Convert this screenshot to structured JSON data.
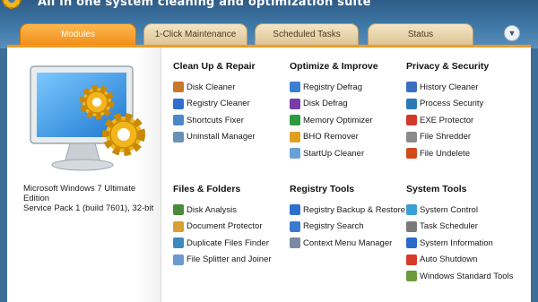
{
  "header": {
    "tagline": "All in one system cleaning and optimization suite"
  },
  "tabs": [
    {
      "label": "Modules",
      "active": true
    },
    {
      "label": "1-Click Maintenance",
      "active": false
    },
    {
      "label": "Scheduled Tasks",
      "active": false
    },
    {
      "label": "Status",
      "active": false
    }
  ],
  "menu_button_icon": "chevron-down-icon",
  "system": {
    "os_info": "Microsoft Windows 7 Ultimate Edition\nService Pack 1 (build 7601), 32-bit"
  },
  "sections": [
    {
      "title": "Clean Up & Repair",
      "items": [
        {
          "label": "Disk Cleaner",
          "icon": "broom-icon",
          "color": "#c9772a"
        },
        {
          "label": "Registry Cleaner",
          "icon": "registry-cube-icon",
          "color": "#2f6fd0"
        },
        {
          "label": "Shortcuts Fixer",
          "icon": "shortcut-icon",
          "color": "#4a89c8"
        },
        {
          "label": "Uninstall Manager",
          "icon": "uninstall-icon",
          "color": "#6a8fb8"
        }
      ]
    },
    {
      "title": "Optimize & Improve",
      "items": [
        {
          "label": "Registry Defrag",
          "icon": "defrag-icon",
          "color": "#3a7fd0"
        },
        {
          "label": "Disk Defrag",
          "icon": "disk-defrag-icon",
          "color": "#7a3aa8"
        },
        {
          "label": "Memory Optimizer",
          "icon": "memory-icon",
          "color": "#2e9a3e"
        },
        {
          "label": "BHO Remover",
          "icon": "bho-icon",
          "color": "#e0a020"
        },
        {
          "label": "StartUp Cleaner",
          "icon": "startup-icon",
          "color": "#6aa0d8"
        }
      ]
    },
    {
      "title": "Privacy & Security",
      "items": [
        {
          "label": "History Cleaner",
          "icon": "history-icon",
          "color": "#3a6fc0"
        },
        {
          "label": "Process Security",
          "icon": "process-icon",
          "color": "#2a7ab8"
        },
        {
          "label": "EXE Protector",
          "icon": "exe-shield-icon",
          "color": "#d23a2a"
        },
        {
          "label": "File Shredder",
          "icon": "shredder-icon",
          "color": "#8a8a8a"
        },
        {
          "label": "File Undelete",
          "icon": "undelete-icon",
          "color": "#d04a1a"
        }
      ]
    },
    {
      "title": "Files & Folders",
      "items": [
        {
          "label": "Disk Analysis",
          "icon": "disk-analysis-icon",
          "color": "#4a8a3a"
        },
        {
          "label": "Document Protector",
          "icon": "document-icon",
          "color": "#d8a030"
        },
        {
          "label": "Duplicate Files Finder",
          "icon": "duplicate-icon",
          "color": "#3a8ac0"
        },
        {
          "label": "File Splitter and Joiner",
          "icon": "splitter-icon",
          "color": "#6a9ad0"
        }
      ]
    },
    {
      "title": "Registry Tools",
      "items": [
        {
          "label": "Registry Backup & Restore",
          "icon": "registry-backup-icon",
          "color": "#2f6fd0"
        },
        {
          "label": "Registry Search",
          "icon": "registry-search-icon",
          "color": "#3a7ad0"
        },
        {
          "label": "Context Menu Manager",
          "icon": "context-menu-icon",
          "color": "#7a8aa0"
        }
      ]
    },
    {
      "title": "System Tools",
      "items": [
        {
          "label": "System Control",
          "icon": "system-control-icon",
          "color": "#3aa0d8"
        },
        {
          "label": "Task Scheduler",
          "icon": "clock-icon",
          "color": "#7a7a7a"
        },
        {
          "label": "System Information",
          "icon": "info-icon",
          "color": "#2a6ac8"
        },
        {
          "label": "Auto Shutdown",
          "icon": "power-icon",
          "color": "#d83a2a"
        },
        {
          "label": "Windows Standard Tools",
          "icon": "windows-tools-icon",
          "color": "#6a9a3a"
        }
      ]
    }
  ]
}
